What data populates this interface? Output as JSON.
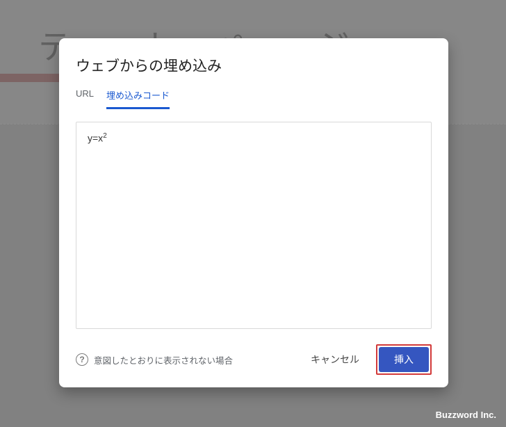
{
  "background": {
    "title_fragment": "テ　　ト　ペ　　ジ"
  },
  "modal": {
    "title": "ウェブからの埋め込み",
    "tabs": [
      {
        "label": "URL",
        "active": false
      },
      {
        "label": "埋め込みコード",
        "active": true
      }
    ],
    "embed_content": {
      "base": "y=x",
      "exponent": "2"
    },
    "help_text": "意図したとおりに表示されない場合",
    "cancel_label": "キャンセル",
    "insert_label": "挿入"
  },
  "footer": {
    "copyright": "Buzzword Inc."
  }
}
